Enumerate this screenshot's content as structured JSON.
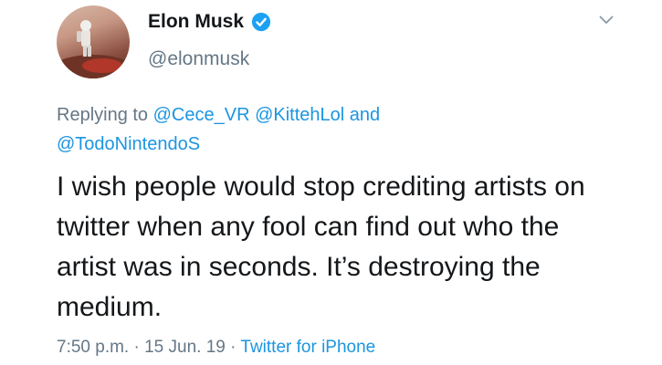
{
  "author": {
    "display_name": "Elon Musk",
    "handle": "@elonmusk",
    "verified": true
  },
  "reply": {
    "prefix": "Replying to",
    "mentions": [
      "@Cece_VR",
      "@KittehLol",
      "@TodoNintendoS"
    ],
    "joiner": "and"
  },
  "tweet": {
    "text": "I wish people would stop crediting artists on twitter when any fool can find out who the artist was in seconds. It’s destroying the medium."
  },
  "meta": {
    "time": "7:50 p.m.",
    "separator": "·",
    "date": "15 Jun. 19",
    "source": "Twitter for iPhone"
  },
  "icons": {
    "verified": "verified-badge-icon",
    "menu": "chevron-down-icon"
  },
  "colors": {
    "link": "#1b95e0",
    "muted": "#657786",
    "text": "#14171a",
    "verified": "#1da1f2"
  }
}
